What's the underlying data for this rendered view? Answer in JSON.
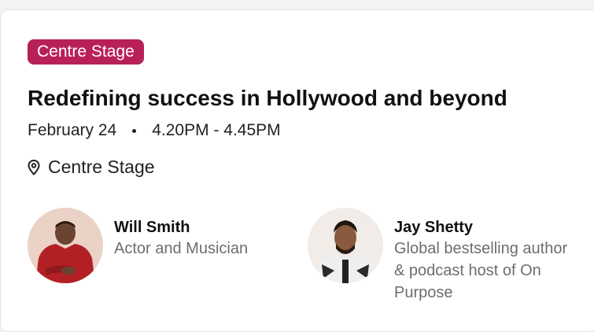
{
  "session": {
    "badge": "Centre Stage",
    "title": "Redefining success in Hollywood and beyond",
    "date": "February 24",
    "time": "4.20PM - 4.45PM",
    "location": "Centre Stage"
  },
  "speakers": [
    {
      "name": "Will Smith",
      "role": "Actor and Musician"
    },
    {
      "name": "Jay Shetty",
      "role": "Global bestselling author & podcast host of On Purpose"
    }
  ],
  "colors": {
    "badge": "#b8205a",
    "card": "#ffffff",
    "muted_text": "#6d6d6d"
  },
  "icons": {
    "location": "map-pin-icon"
  }
}
